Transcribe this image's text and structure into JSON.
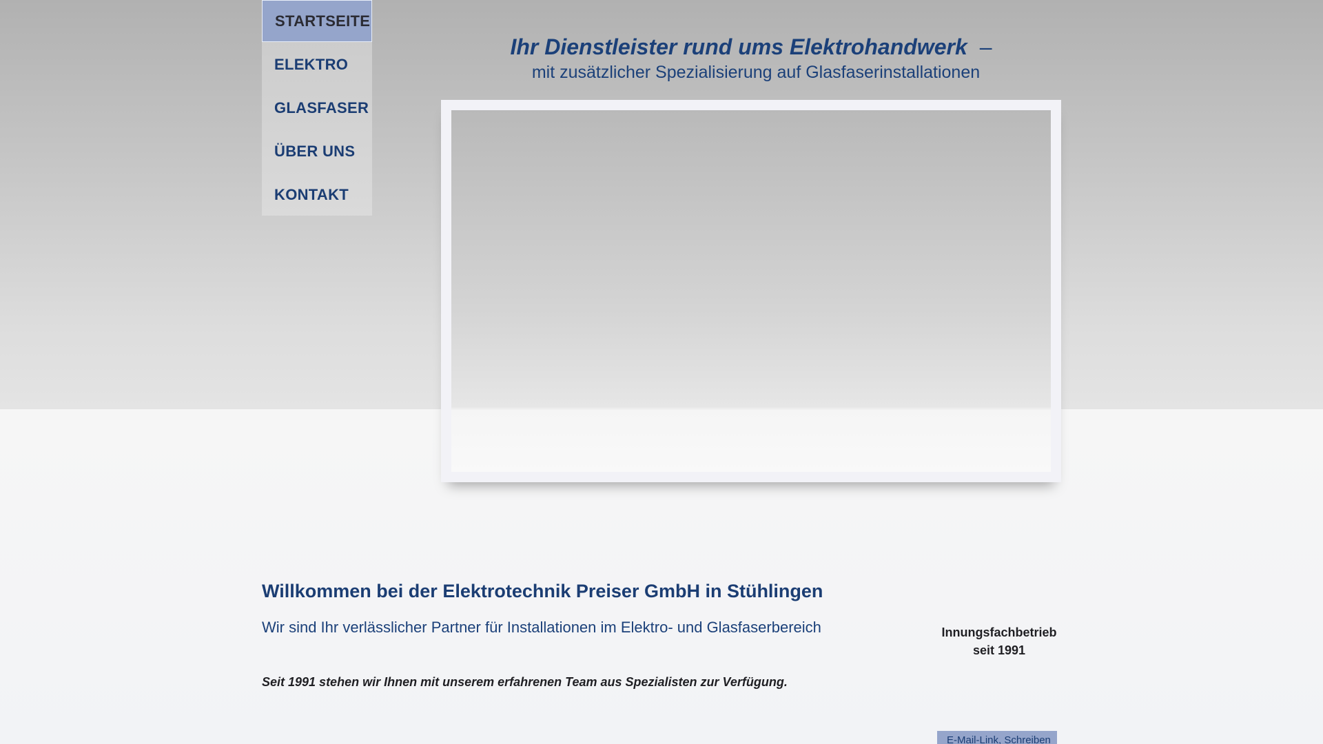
{
  "nav": {
    "items": [
      {
        "label": "STARTSEITE",
        "active": true
      },
      {
        "label": "ELEKTRO",
        "active": false
      },
      {
        "label": "GLASFASER",
        "active": false
      },
      {
        "label": "ÜBER UNS",
        "active": false
      },
      {
        "label": "KONTAKT",
        "active": false
      }
    ]
  },
  "header": {
    "headline": "Ihr Dienstleister rund ums Elektrohandwerk",
    "dash": "–",
    "subline": "mit zusätzlicher Spezialisierung auf Glasfaserinstallationen"
  },
  "main": {
    "title": "Willkommen bei der Elektrotechnik Preiser GmbH in Stühlingen",
    "subtitle": "Wir sind Ihr verlässlicher Partner für Installationen im Elektro- und Glasfaserbereich",
    "text": "Seit 1991 stehen wir Ihnen mit unserem erfahrenen Team aus Spezialisten zur Verfügung."
  },
  "badge": {
    "line1": "Innungsfachbetrieb",
    "line2": "seit 1991"
  },
  "email_button": {
    "label": "E-Mail-Link, Schreiben"
  },
  "colors": {
    "brand_blue": "#1b3d73",
    "nav_active": "#95a5cb"
  }
}
